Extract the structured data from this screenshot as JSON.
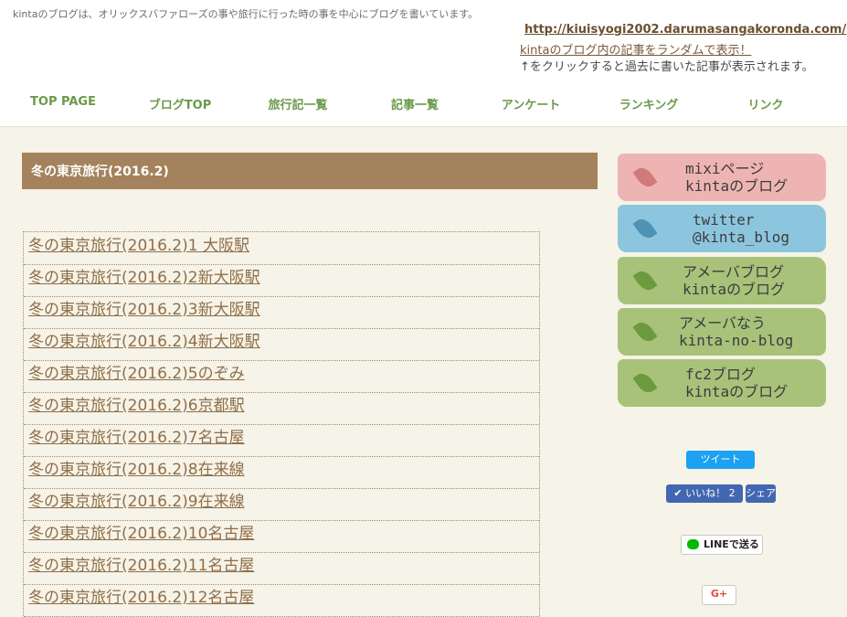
{
  "header": {
    "tagline": "kintaのブログは、オリックスバファローズの事や旅行に行った時の事を中心にブログを書いています。",
    "site_url": "http://kiuisyogi2002.darumasangakoronda.com/",
    "random_link": "kintaのブログ内の記事をランダムで表示！",
    "hint": "↑をクリックすると過去に書いた記事が表示されます。"
  },
  "nav": {
    "items": [
      {
        "label": "TOP PAGE"
      },
      {
        "label": "ブログTOP"
      },
      {
        "label": "旅行記一覧"
      },
      {
        "label": "記事一覧"
      },
      {
        "label": "アンケート"
      },
      {
        "label": "ランキング"
      },
      {
        "label": "リンク"
      }
    ]
  },
  "main": {
    "title": "冬の東京旅行(2016.2)",
    "articles": [
      "冬の東京旅行(2016.2)1 大阪駅",
      "冬の東京旅行(2016.2)2新大阪駅",
      "冬の東京旅行(2016.2)3新大阪駅",
      "冬の東京旅行(2016.2)4新大阪駅",
      "冬の東京旅行(2016.2)5のぞみ",
      "冬の東京旅行(2016.2)6京都駅",
      "冬の東京旅行(2016.2)7名古屋",
      "冬の東京旅行(2016.2)8在来線",
      "冬の東京旅行(2016.2)9在来線",
      "冬の東京旅行(2016.2)10名古屋",
      "冬の東京旅行(2016.2)11名古屋",
      "冬の東京旅行(2016.2)12名古屋"
    ]
  },
  "sidebar": {
    "banners": [
      {
        "line1": "mixiページ",
        "line2": "kintaのブログ",
        "bg": "#eeb4b4",
        "leaf": "#d27a7a",
        "icon": "leaf-icon"
      },
      {
        "line1": "twitter",
        "line2": "@kinta_blog",
        "bg": "#8cc6de",
        "leaf": "#4e93b5",
        "icon": "leaf-icon"
      },
      {
        "line1": "アメーバブログ",
        "line2": "kintaのブログ",
        "bg": "#a8c27a",
        "leaf": "#6c9a3e",
        "icon": "leaf-icon"
      },
      {
        "line1": "アメーバなう",
        "line2": "kinta-no-blog",
        "bg": "#a8c27a",
        "leaf": "#6c9a3e",
        "icon": "leaf-icon"
      },
      {
        "line1": "fc2ブログ",
        "line2": "kintaのブログ",
        "bg": "#a8c27a",
        "leaf": "#6c9a3e",
        "icon": "leaf-icon"
      }
    ]
  },
  "social": {
    "tweet": "ツイート",
    "like": "✔ いいね！ 2",
    "share": "シェア",
    "line": "LINEで送る",
    "gplus": "G+"
  }
}
